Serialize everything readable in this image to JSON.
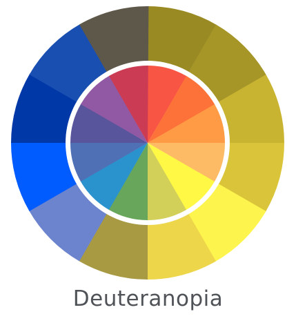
{
  "title": "Deuteranopia",
  "wheel": {
    "outer_ring_colors": [
      "#9A8A24",
      "#A69628",
      "#C8B431",
      "#DAC53A",
      "#FEF44E",
      "#EDD649",
      "#A89A43",
      "#6C83CD",
      "#005CFE",
      "#0038A8",
      "#1A4FB2",
      "#5D584A"
    ],
    "inner_disc_colors": [
      "#F85545",
      "#FD7239",
      "#FE9B44",
      "#FEBB65",
      "#FFF845",
      "#D2D058",
      "#68A75B",
      "#2A92CD",
      "#4F70B5",
      "#59559C",
      "#9159A3",
      "#CB3B53"
    ],
    "separator_color": "#ffffff"
  }
}
